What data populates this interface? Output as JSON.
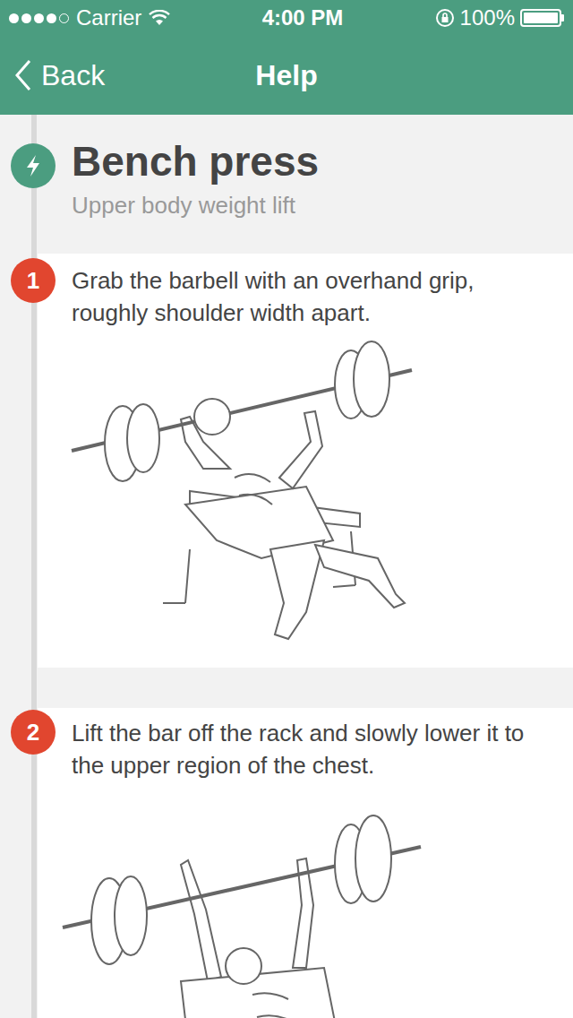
{
  "status_bar": {
    "signal": {
      "level": 0.8
    },
    "carrier": "Carrier",
    "time": "4:00 PM",
    "battery": "100%",
    "battery_level": 1
  },
  "nav": {
    "back": "Back",
    "title": "Help"
  },
  "exercise": {
    "title": "Bench press",
    "subtitle": "Upper body weight lift"
  },
  "steps": [
    {
      "number": "1",
      "text": "Grab the barbell with an overhand grip, roughly shoulder width apart."
    },
    {
      "number": "2",
      "text": "Lift the bar off the rack and slowly lower it to the upper region of the chest."
    }
  ]
}
